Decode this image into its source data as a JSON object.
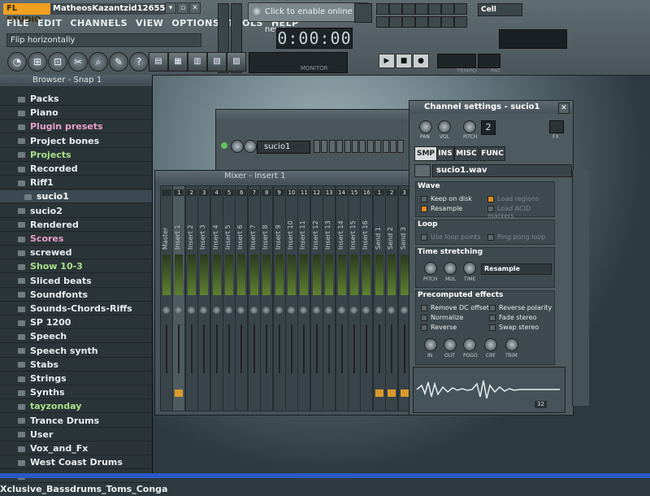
{
  "app": {
    "logo": "FL STUDIO",
    "project_name": "MatheosKazantzid1265571",
    "hint": "Flip horizontally",
    "news": "Click to enable online news",
    "time": "0:00:00",
    "monitor_label": "MONITOR",
    "cell_select": "Cell",
    "tempo_label": "TEMPO",
    "pat_label": "PAT"
  },
  "menu": [
    "FILE",
    "EDIT",
    "CHANNELS",
    "VIEW",
    "OPTIONS",
    "TOOLS",
    "HELP"
  ],
  "browser": {
    "title": "Browser - Snap 1",
    "items": [
      {
        "label": "Packs",
        "color": "#e8eef0"
      },
      {
        "label": "Piano",
        "color": "#e8eef0"
      },
      {
        "label": "Plugin presets",
        "color": "#e8a0c8"
      },
      {
        "label": "Project bones",
        "color": "#e8eef0"
      },
      {
        "label": "Projects",
        "color": "#a8e08a"
      },
      {
        "label": "Recorded",
        "color": "#e8eef0"
      },
      {
        "label": "Riff1",
        "color": "#e8eef0"
      },
      {
        "label": "sucio1",
        "color": "#ffffff"
      },
      {
        "label": "sucio2",
        "color": "#e8eef0"
      },
      {
        "label": "Rendered",
        "color": "#e8eef0"
      },
      {
        "label": "Scores",
        "color": "#e8a0c8"
      },
      {
        "label": "screwed",
        "color": "#e8eef0"
      },
      {
        "label": "Show 10-3",
        "color": "#a8e08a"
      },
      {
        "label": "Sliced beats",
        "color": "#e8eef0"
      },
      {
        "label": "Soundfonts",
        "color": "#e8eef0"
      },
      {
        "label": "Sounds-Chords-Riffs",
        "color": "#e8eef0"
      },
      {
        "label": "SP 1200",
        "color": "#e8eef0"
      },
      {
        "label": "Speech",
        "color": "#e8eef0"
      },
      {
        "label": "Speech synth",
        "color": "#e8eef0"
      },
      {
        "label": "Stabs",
        "color": "#e8eef0"
      },
      {
        "label": "Strings",
        "color": "#e8eef0"
      },
      {
        "label": "Synths",
        "color": "#e8eef0"
      },
      {
        "label": "tayzonday",
        "color": "#a8e08a"
      },
      {
        "label": "Trance Drums",
        "color": "#e8eef0"
      },
      {
        "label": "User",
        "color": "#e8eef0"
      },
      {
        "label": "Vox_and_Fx",
        "color": "#e8eef0"
      },
      {
        "label": "West Coast Drums",
        "color": "#e8eef0"
      },
      {
        "label": "Xclusive_Bassdrums_Toms_Conga",
        "color": "#e8eef0"
      }
    ]
  },
  "rack": {
    "channel_label": "sucio1"
  },
  "mixer": {
    "title": "Mixer - Insert 1",
    "strips": [
      "Master",
      "Insert 1",
      "Insert 2",
      "Insert 3",
      "Insert 4",
      "Insert 5",
      "Insert 6",
      "Insert 7",
      "Insert 8",
      "Insert 9",
      "Insert 10",
      "Insert 11",
      "Insert 12",
      "Insert 13",
      "Insert 14",
      "Insert 15",
      "Insert 16",
      "Send 1",
      "Send 2",
      "Send 3"
    ],
    "strip_numbers": [
      "",
      "1",
      "2",
      "3",
      "4",
      "5",
      "6",
      "7",
      "8",
      "9",
      "10",
      "11",
      "12",
      "13",
      "14",
      "15",
      "16",
      "1",
      "2",
      "3"
    ]
  },
  "channel_settings": {
    "title": "Channel settings - sucio1",
    "knob_labels": [
      "PAN",
      "VOL",
      "PITCH"
    ],
    "pitch_value": "2",
    "fx_label": "FX",
    "tabs": [
      "SMP",
      "INS",
      "MISC",
      "FUNC"
    ],
    "file": "sucio1.wav",
    "wave": {
      "head": "Wave",
      "keep_on_disk": "Keep on disk",
      "resample": "Resample",
      "load_regions": "Load regions",
      "load_acid_markers": "Load ACID markers"
    },
    "loop": {
      "head": "Loop",
      "use_loop_points": "Use loop points",
      "ping_pong_loop": "Ping pong loop"
    },
    "time_stretching": {
      "head": "Time stretching",
      "knobs": [
        "PITCH",
        "MUL",
        "TIME"
      ],
      "mode": "Resample"
    },
    "precomputed": {
      "head": "Precomputed effects",
      "remove_dc": "Remove DC offset",
      "normalize": "Normalize",
      "reverse": "Reverse",
      "reverse_polarity": "Reverse polarity",
      "fade_stereo": "Fade stereo",
      "swap_stereo": "Swap stereo",
      "knobs": [
        "IN",
        "OUT",
        "POGO",
        "CRF",
        "TRIM"
      ]
    },
    "wave_value": "32"
  }
}
